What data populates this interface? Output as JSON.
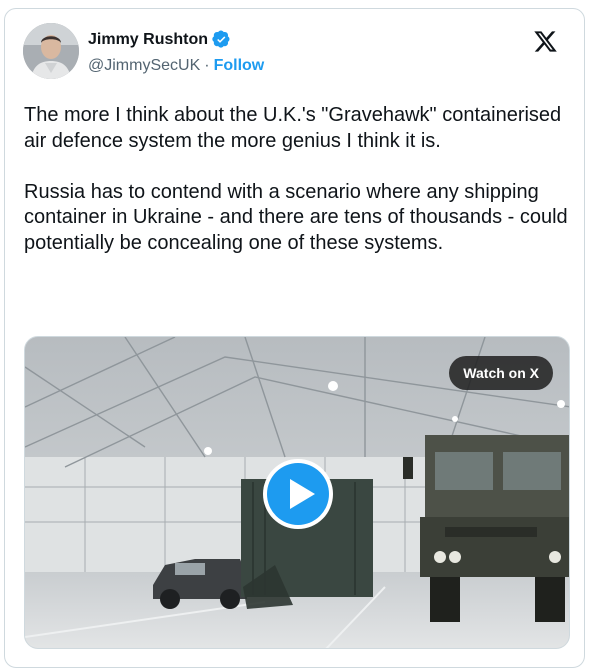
{
  "author": {
    "name": "Jimmy Rushton",
    "handle": "@JimmySecUK",
    "separator": "·",
    "follow_label": "Follow",
    "verified_icon": "verified-badge-icon"
  },
  "platform_icon": "x-logo-icon",
  "tweet": {
    "text": "The more I think about the U.K.'s \"Gravehawk\" containerised air defence system the more genius I think it is.\n\nRussia has to contend with a scenario where any shipping container in Ukraine - and there are tens of thousands - could potentially be concealing one of these systems."
  },
  "media": {
    "type": "video",
    "watch_label": "Watch on X",
    "play_icon": "play-icon"
  },
  "colors": {
    "accent": "#1d9bf0",
    "text": "#0f1419",
    "muted": "#536471",
    "border": "#cfd9de"
  }
}
